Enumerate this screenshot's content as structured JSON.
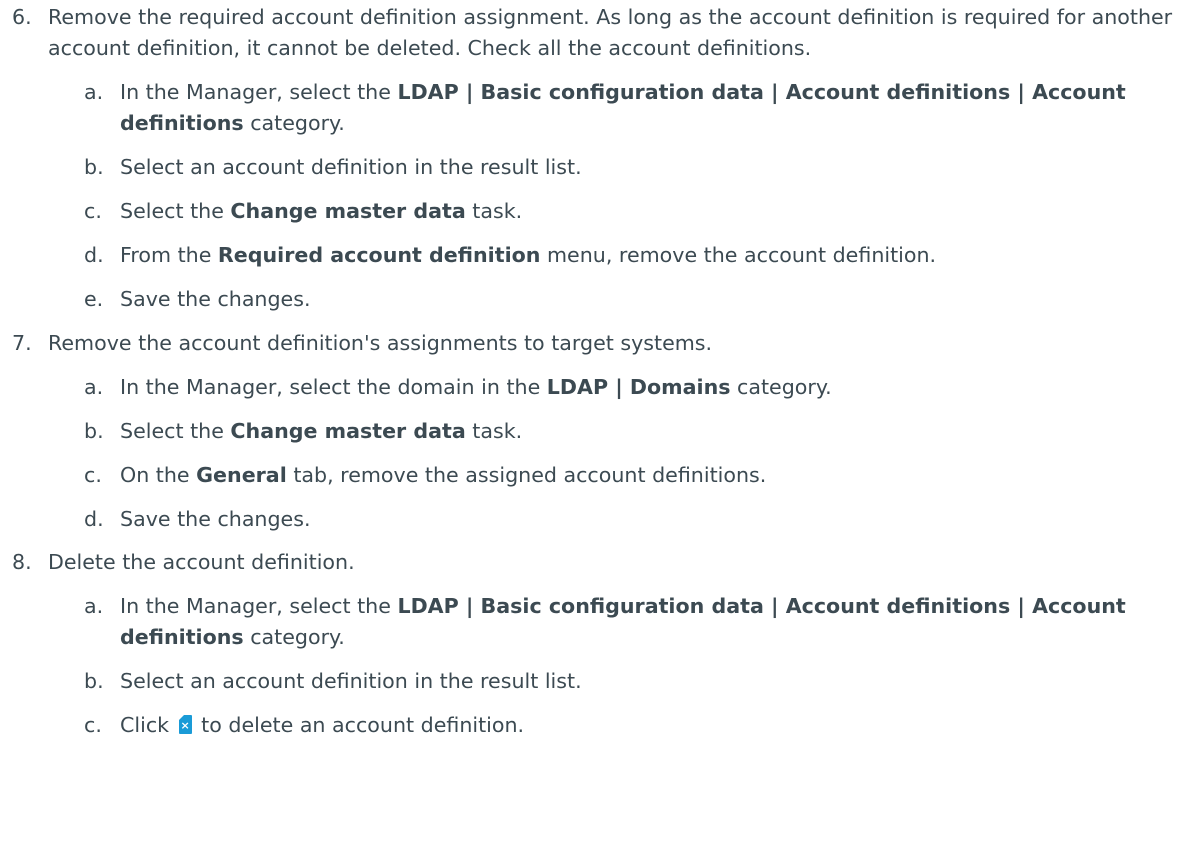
{
  "steps": [
    {
      "number": "6.",
      "text": "Remove the required account definition assignment. As long as the account definition is required for another account definition, it cannot be deleted. Check all the account definitions.",
      "substeps": [
        {
          "letter": "a.",
          "pre": "In the Manager, select the ",
          "bold": "LDAP | Basic configuration data | Account definitions | Account definitions",
          "post": " category."
        },
        {
          "letter": "b.",
          "text": "Select an account definition in the result list."
        },
        {
          "letter": "c.",
          "pre": "Select the ",
          "bold": "Change master data",
          "post": " task."
        },
        {
          "letter": "d.",
          "pre": "From the ",
          "bold": "Required account definition",
          "post": " menu, remove the account definition."
        },
        {
          "letter": "e.",
          "text": "Save the changes."
        }
      ]
    },
    {
      "number": "7.",
      "text": "Remove the account definition's assignments to target systems.",
      "substeps": [
        {
          "letter": "a.",
          "pre": "In the Manager, select the domain in the ",
          "bold": "LDAP | Domains",
          "post": " category."
        },
        {
          "letter": "b.",
          "pre": "Select the ",
          "bold": "Change master data",
          "post": " task."
        },
        {
          "letter": "c.",
          "pre": "On the ",
          "bold": "General",
          "post": " tab, remove the assigned account definitions."
        },
        {
          "letter": "d.",
          "text": "Save the changes."
        }
      ]
    },
    {
      "number": "8.",
      "text": "Delete the account definition.",
      "substeps": [
        {
          "letter": "a.",
          "pre": "In the Manager, select the ",
          "bold": "LDAP | Basic configuration data | Account definitions | Account definitions",
          "post": " category."
        },
        {
          "letter": "b.",
          "text": "Select an account definition in the result list."
        },
        {
          "letter": "c.",
          "pre": "Click ",
          "icon": "delete-account-definition-icon",
          "post": " to delete an account definition."
        }
      ]
    }
  ],
  "colors": {
    "text": "#3c4a52",
    "icon": "#1a9bd7"
  }
}
